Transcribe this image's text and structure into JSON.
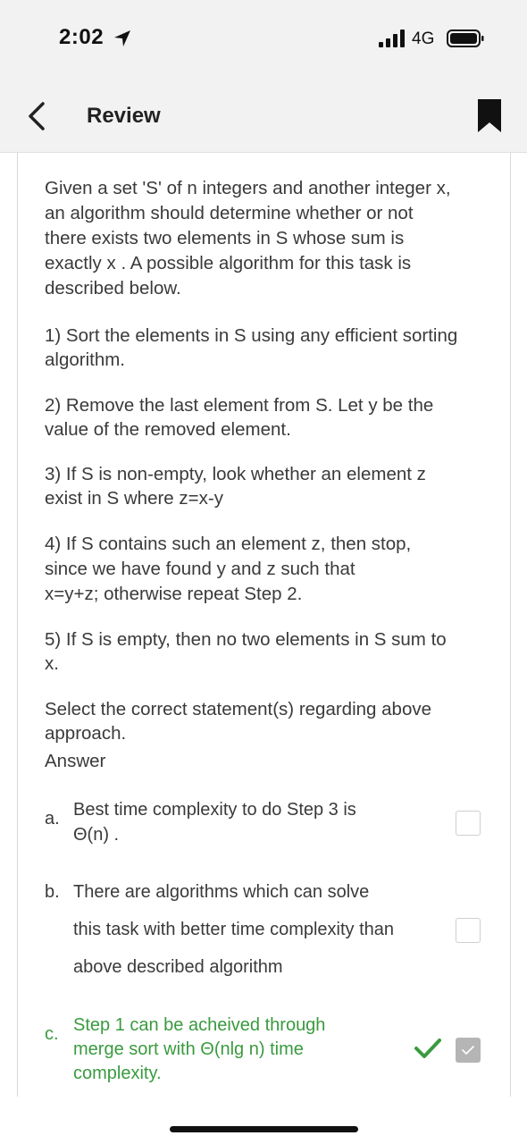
{
  "status": {
    "time": "2:02",
    "network": "4G"
  },
  "nav": {
    "title": "Review"
  },
  "question": {
    "intro": [
      "Given a set 'S' of n integers and another integer x,",
      "an algorithm should determine whether or not",
      "there exists two elements in S whose sum is",
      "exactly x . A possible algorithm for this task is",
      "described below."
    ],
    "step1": [
      "1) Sort the elements in S using any efficient sorting",
      "algorithm."
    ],
    "step2": [
      "2) Remove the last element from S. Let y be the",
      "value of the removed element."
    ],
    "step3": [
      "3) If S is non-empty, look whether an element z",
      "exist in S where z=x-y"
    ],
    "step4": [
      "4) If S contains such an element z, then stop,",
      "since we have found y and z such that",
      "x=y+z; otherwise repeat Step 2."
    ],
    "step5": [
      "5) If S is empty, then no two elements in S sum to",
      "x."
    ],
    "prompt": [
      "Select the correct statement(s) regarding above",
      "approach."
    ],
    "answer_label": "Answer"
  },
  "options": [
    {
      "letter": "a.",
      "lines": [
        "Best time complexity to do Step 3 is",
        "Θ(n) ."
      ],
      "checked": false
    },
    {
      "letter": "b.",
      "lines": [
        "There are algorithms which can solve",
        "this task with better time complexity than",
        "above described algorithm"
      ],
      "checked": false
    },
    {
      "letter": "c.",
      "lines": [
        "Step 1 can be acheived through",
        "merge sort with Θ(nlg n) time",
        "complexity."
      ],
      "checked": true,
      "status": "correct"
    }
  ],
  "colors": {
    "correct": "#3a9a3f",
    "text": "#3a3a3a",
    "bar": "#f2f2f2"
  },
  "icons": [
    "location-arrow-icon",
    "signal-icon",
    "battery-icon",
    "back-chevron-icon",
    "bookmark-icon",
    "checkmark-icon"
  ]
}
